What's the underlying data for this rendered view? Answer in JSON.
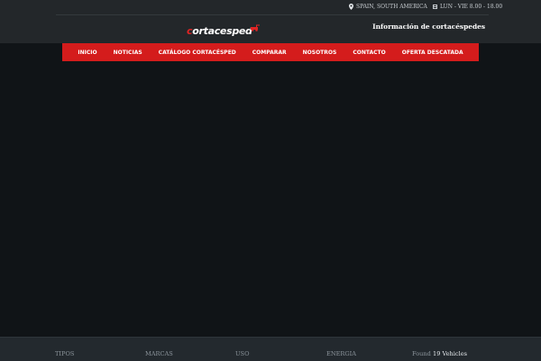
{
  "topbar": {
    "location_icon": "map-pin-icon",
    "location": "SPAIN, SOUTH AMERICA",
    "hours_icon": "calendar-icon",
    "hours": "LUN - VIE 8.00 - 18.00"
  },
  "logo": {
    "first_letter": "c",
    "rest": "ortacesped",
    "icon": "lawn-mower-icon"
  },
  "header": {
    "info_link": "Información de cortacéspedes"
  },
  "nav": {
    "items": [
      {
        "label": "INICIO"
      },
      {
        "label": "NOTICIAS"
      },
      {
        "label": "CATÁLOGO CORTACÉSPED"
      },
      {
        "label": "COMPARAR"
      },
      {
        "label": "NOSOTROS"
      },
      {
        "label": "CONTACTO"
      },
      {
        "label": "OFERTA DESCATADA"
      }
    ]
  },
  "footer": {
    "tipos": "TIPOS",
    "marcas": "MARCAS",
    "uso": "USO",
    "energia": "ENERGIA",
    "found_label": "Found",
    "found_count": "19 Vehicles"
  },
  "colors": {
    "accent": "#d41c1c",
    "header_bg": "#23272a",
    "body_bg": "#101417",
    "footer_bg": "#23292e"
  }
}
